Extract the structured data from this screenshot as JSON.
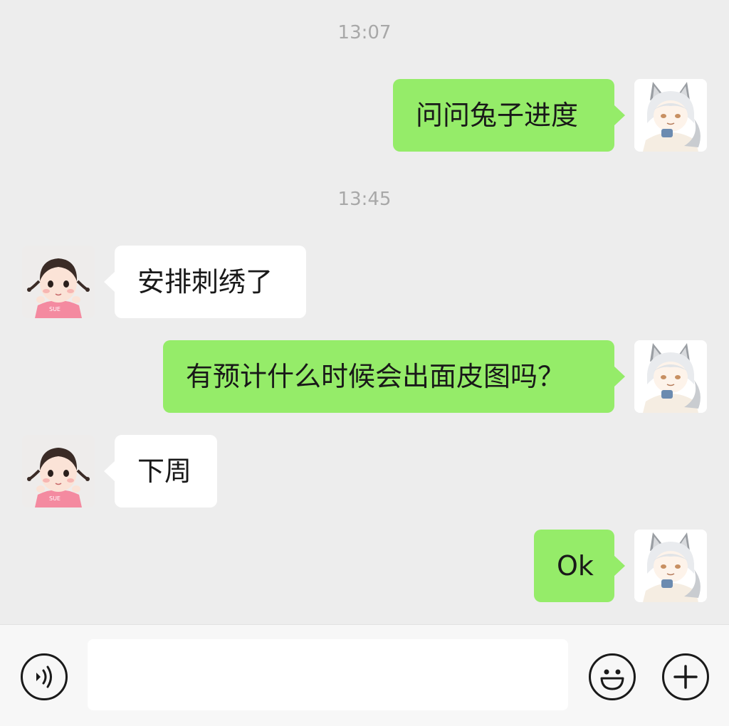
{
  "messages": [
    {
      "type": "time",
      "text": "13:07"
    },
    {
      "type": "out",
      "text": "问问兔子进度"
    },
    {
      "type": "time",
      "text": "13:45"
    },
    {
      "type": "in",
      "text": "安排刺绣了"
    },
    {
      "type": "out",
      "text": "有预计什么时候会出面皮图吗？"
    },
    {
      "type": "in",
      "text": "下周"
    },
    {
      "type": "out",
      "text": "Ok"
    }
  ],
  "input": {
    "value": "",
    "placeholder": ""
  },
  "icons": {
    "voice": "voice-icon",
    "emoji": "emoji-icon",
    "more": "plus-icon"
  },
  "colors": {
    "background": "#ededed",
    "outgoing_bubble": "#95ec69",
    "incoming_bubble": "#ffffff",
    "timestamp": "#a8a8a8"
  }
}
